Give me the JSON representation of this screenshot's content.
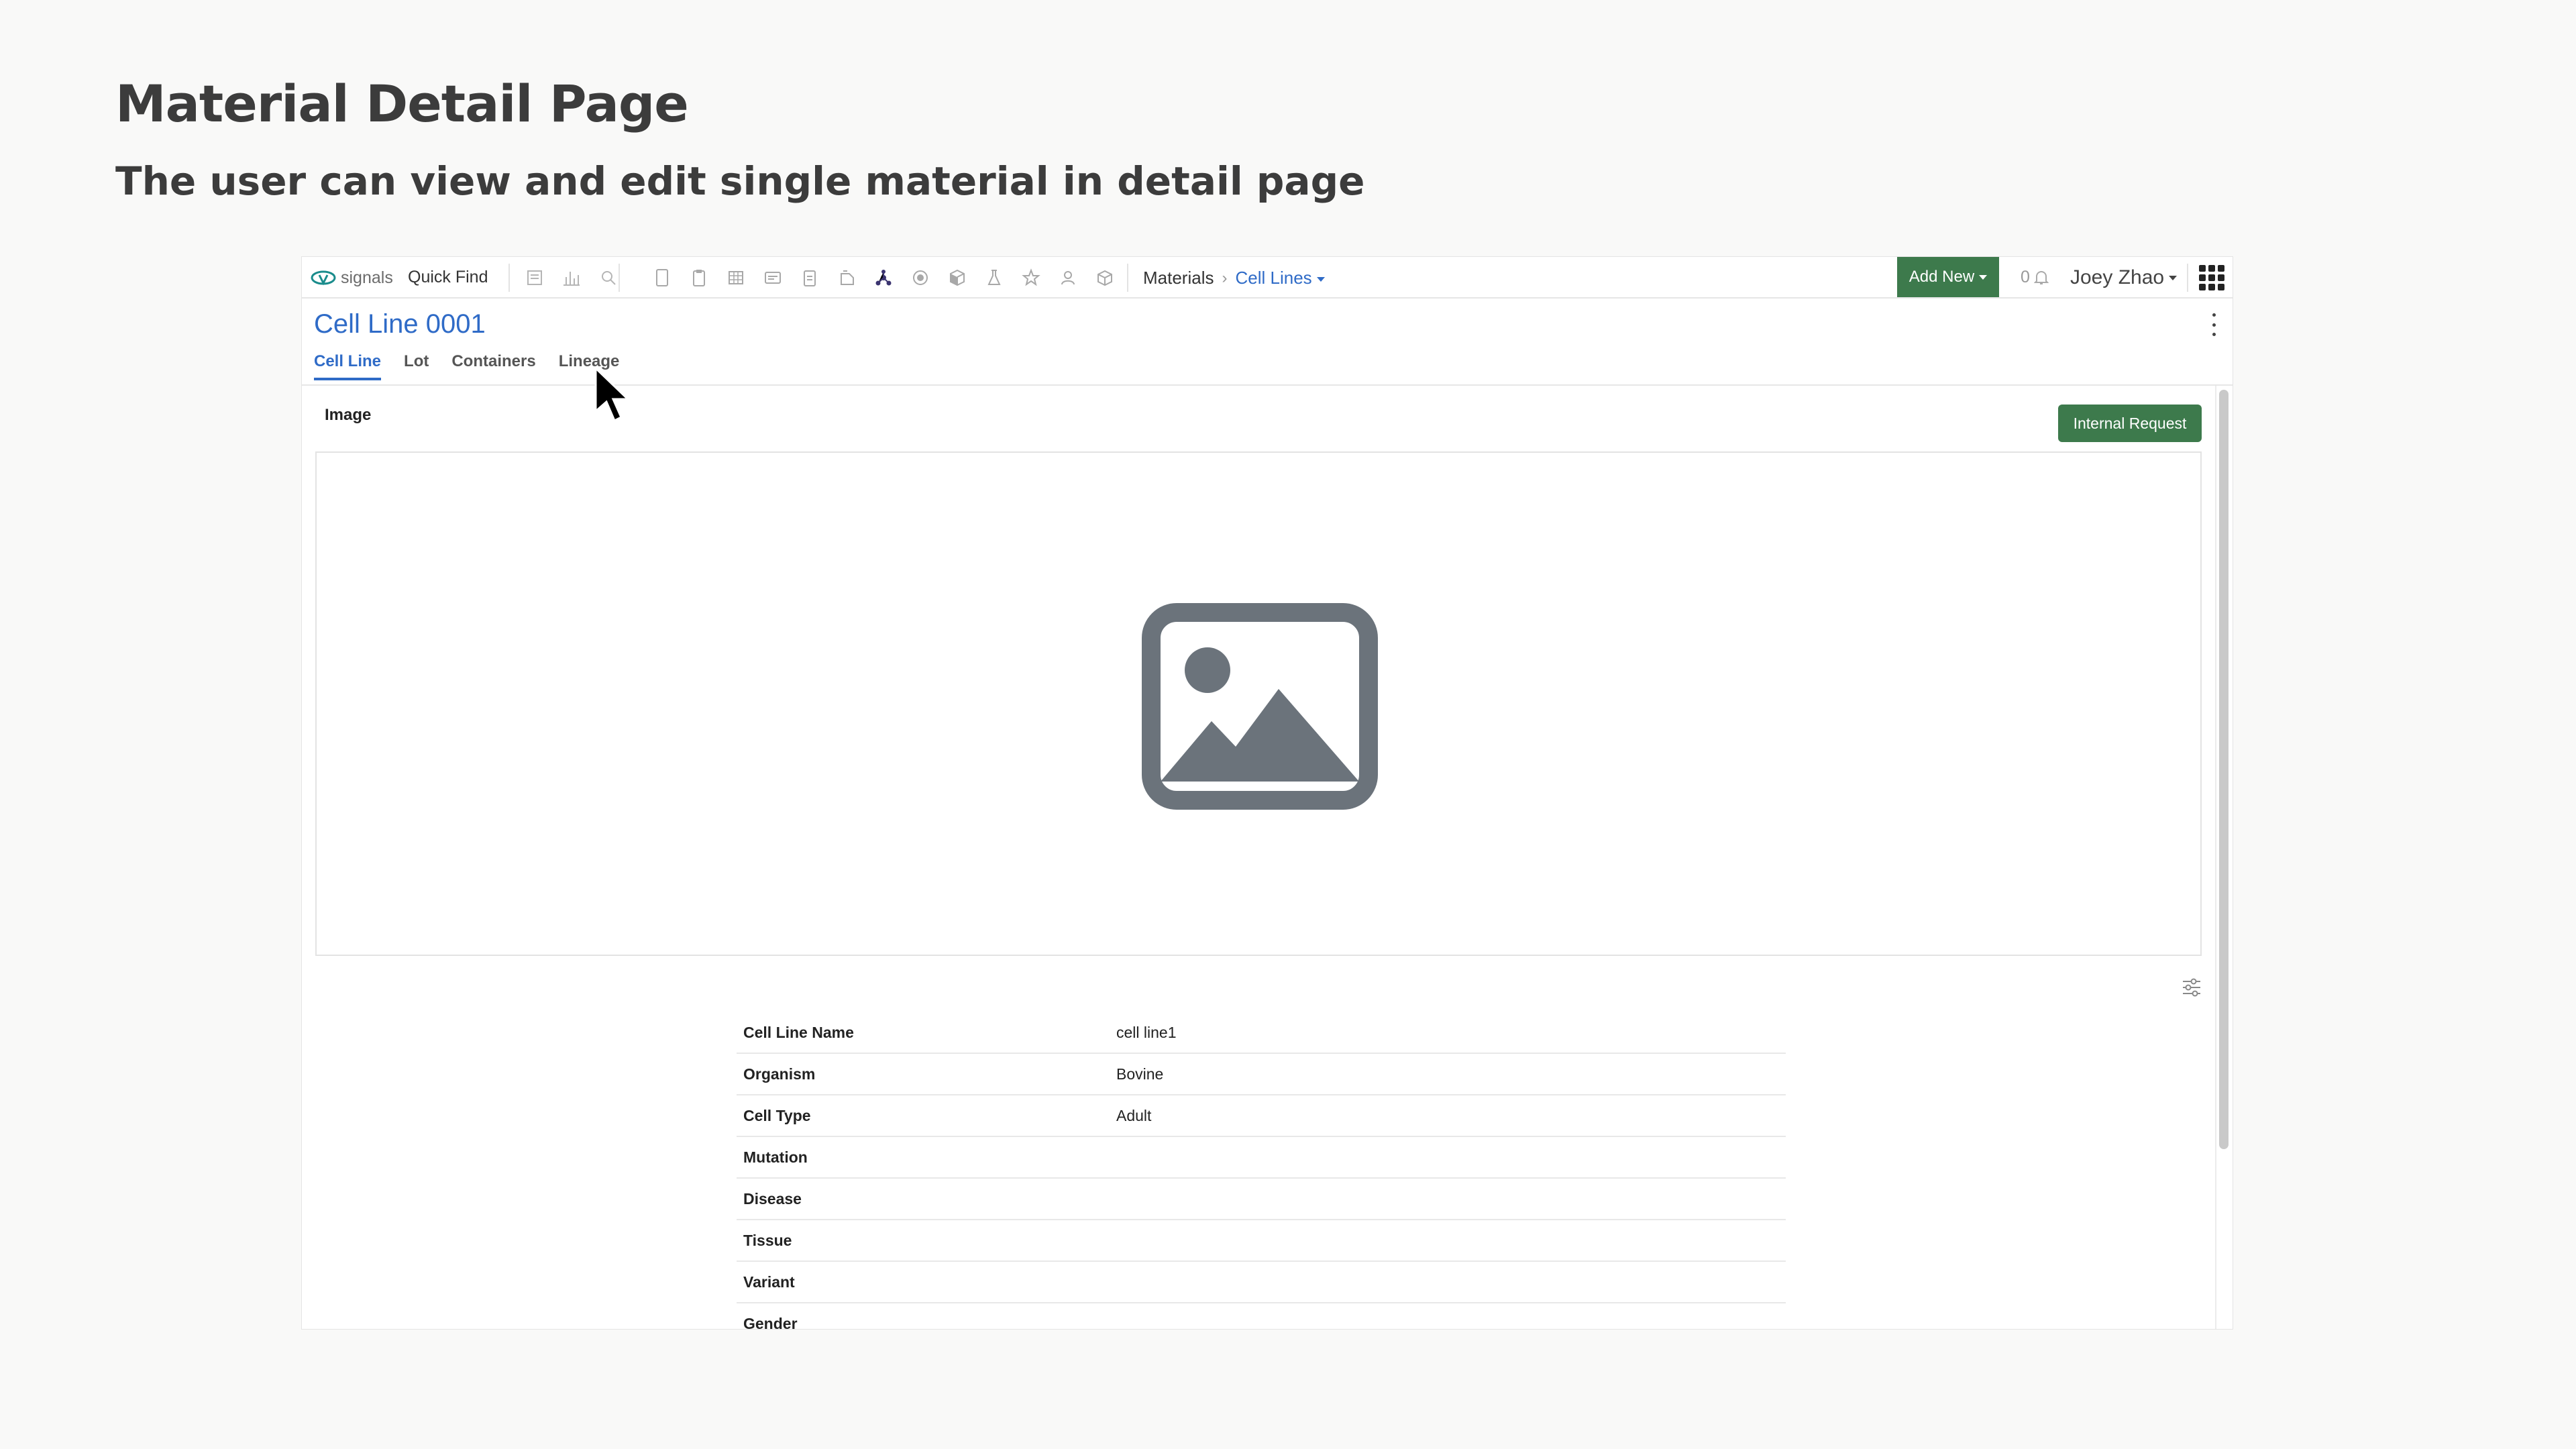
{
  "slide": {
    "title": "Material Detail Page",
    "subtitle": "The user can view and edit single material in detail page"
  },
  "app": {
    "logo_text": "signals",
    "quick_find": "Quick Find",
    "nav_icons": [
      "notebook-icon",
      "chart-icon",
      "search-icon",
      "document-icon",
      "clipboard-icon",
      "grid-icon",
      "inbox-icon",
      "report-icon",
      "flask-icon",
      "molecule-icon",
      "target-icon",
      "cube-icon",
      "beaker-icon",
      "star-icon",
      "user-group-icon",
      "box-icon"
    ],
    "breadcrumb": {
      "root": "Materials",
      "current": "Cell Lines"
    },
    "add_new": "Add New",
    "notifications_count": "0",
    "user_name": "Joey Zhao",
    "accent_green": "#3d7a4c",
    "link_blue": "#2f6bc7"
  },
  "page": {
    "title": "Cell Line 0001",
    "tabs": [
      {
        "label": "Cell Line",
        "active": true
      },
      {
        "label": "Lot",
        "active": false
      },
      {
        "label": "Containers",
        "active": false
      },
      {
        "label": "Lineage",
        "active": false
      }
    ],
    "image_label": "Image",
    "internal_request": "Internal Request"
  },
  "properties": [
    {
      "label": "Cell Line Name",
      "value": "cell line1"
    },
    {
      "label": "Organism",
      "value": "Bovine"
    },
    {
      "label": "Cell Type",
      "value": "Adult"
    },
    {
      "label": "Mutation",
      "value": ""
    },
    {
      "label": "Disease",
      "value": ""
    },
    {
      "label": "Tissue",
      "value": ""
    },
    {
      "label": "Variant",
      "value": ""
    },
    {
      "label": "Gender",
      "value": ""
    }
  ]
}
